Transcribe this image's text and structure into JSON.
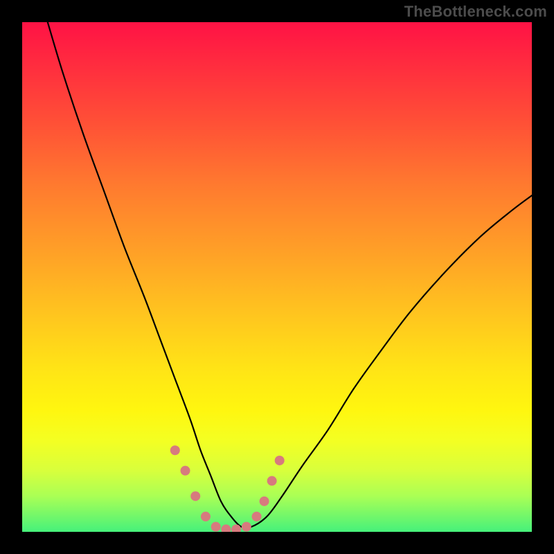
{
  "watermark": "TheBottleneck.com",
  "chart_data": {
    "type": "line",
    "title": "",
    "xlabel": "",
    "ylabel": "",
    "xlim": [
      0,
      100
    ],
    "ylim": [
      0,
      100
    ],
    "grid": false,
    "legend": false,
    "annotations": [],
    "background": {
      "type": "vertical-gradient",
      "stops": [
        {
          "pos": 0,
          "color": "#ff1245"
        },
        {
          "pos": 8,
          "color": "#ff2b3f"
        },
        {
          "pos": 20,
          "color": "#ff5136"
        },
        {
          "pos": 32,
          "color": "#ff7a2f"
        },
        {
          "pos": 45,
          "color": "#ffa027"
        },
        {
          "pos": 57,
          "color": "#ffc41f"
        },
        {
          "pos": 68,
          "color": "#ffe416"
        },
        {
          "pos": 76,
          "color": "#fff60f"
        },
        {
          "pos": 82,
          "color": "#f4ff22"
        },
        {
          "pos": 88,
          "color": "#d8ff3c"
        },
        {
          "pos": 93,
          "color": "#aaff55"
        },
        {
          "pos": 100,
          "color": "#46f17b"
        }
      ]
    },
    "series": [
      {
        "name": "bottleneck-curve",
        "color": "#000000",
        "x": [
          5,
          8,
          12,
          16,
          20,
          24,
          27,
          30,
          33,
          35,
          37,
          39,
          41,
          43,
          45,
          48,
          51,
          55,
          60,
          65,
          70,
          76,
          83,
          90,
          96,
          100
        ],
        "y": [
          100,
          90,
          78,
          67,
          56,
          46,
          38,
          30,
          22,
          16,
          11,
          6,
          3,
          1,
          1,
          3,
          7,
          13,
          20,
          28,
          35,
          43,
          51,
          58,
          63,
          66
        ]
      }
    ],
    "markers": {
      "name": "highlight-dots",
      "color": "#d77a7e",
      "radius_px": 7,
      "points": [
        {
          "x": 30,
          "y": 16
        },
        {
          "x": 32,
          "y": 12
        },
        {
          "x": 34,
          "y": 7
        },
        {
          "x": 36,
          "y": 3
        },
        {
          "x": 38,
          "y": 1
        },
        {
          "x": 40,
          "y": 0.5
        },
        {
          "x": 42,
          "y": 0.5
        },
        {
          "x": 44,
          "y": 1
        },
        {
          "x": 46,
          "y": 3
        },
        {
          "x": 47.5,
          "y": 6
        },
        {
          "x": 49,
          "y": 10
        },
        {
          "x": 50.5,
          "y": 14
        }
      ]
    }
  }
}
